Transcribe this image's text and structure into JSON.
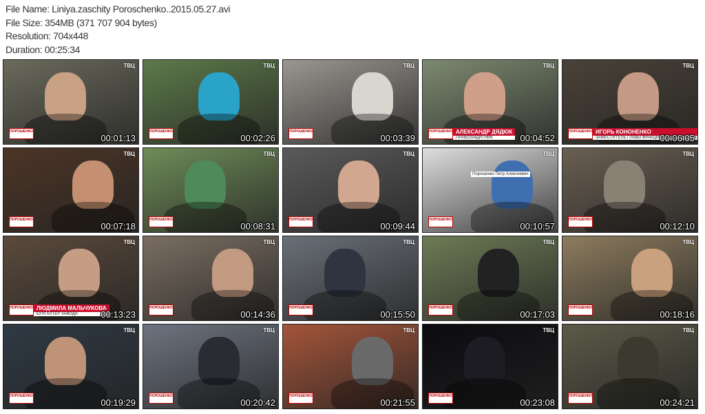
{
  "info": {
    "file_name": "File Name: Liniya.zaschity Poroschenko..2015.05.27.avi",
    "file_size": "File Size: 354MB (371 707 904 bytes)",
    "resolution": "Resolution: 704x448",
    "duration": "Duration: 00:25:34"
  },
  "logo_text": "ПОРОШЕНКО",
  "channel_mark": "ТВЦ",
  "thumbnails": [
    {
      "time": "00:01:13",
      "bg": "#6b6a5c",
      "fg": "#c9a184"
    },
    {
      "time": "00:02:26",
      "bg": "#5d7a4a",
      "fg": "#2aa3c8"
    },
    {
      "time": "00:03:39",
      "bg": "#9a9690",
      "fg": "#d8d6cf"
    },
    {
      "time": "00:04:52",
      "bg": "#7c8a70",
      "fg": "#cf9f8a",
      "caption": "АЛЕКСАНДР ДЯДЮК",
      "sub": "ПРАВОЗАЩИТНИК"
    },
    {
      "time": "00:06:05",
      "bg": "#4a4238",
      "fg": "#c49a84",
      "caption": "ИГОРЬ КОНОНЕНКО",
      "sub": "ЗАМЕСТИТЕЛЬ ГЛАВЫ ФРАКЦИИ «БЛОК ПЕТРА ПОРОШЕНКО»"
    },
    {
      "time": "00:07:18",
      "bg": "#4c3526",
      "fg": "#c49071"
    },
    {
      "time": "00:08:31",
      "bg": "#6f8c58",
      "fg": "#4f8a5a"
    },
    {
      "time": "00:09:44",
      "bg": "#5a5a5a",
      "fg": "#d1a88f"
    },
    {
      "time": "00:10:57",
      "bg": "#dedede",
      "fg": "#3f6fb0",
      "page_title": "Порошенко Петр Алексеевич"
    },
    {
      "time": "00:12:10",
      "bg": "#6a5f52",
      "fg": "#8a8175"
    },
    {
      "time": "00:13:23",
      "bg": "#5b4a3c",
      "fg": "#c49d84",
      "caption": "ЛЮДМИЛА МАЛЬЧУКОВА",
      "sub": "БУХГАЛТЕР ЗАВОДА"
    },
    {
      "time": "00:14:36",
      "bg": "#7a6e62",
      "fg": "#c19a81"
    },
    {
      "time": "00:15:50",
      "bg": "#6a7078",
      "fg": "#2f3540"
    },
    {
      "time": "00:17:03",
      "bg": "#6d7b55",
      "fg": "#222222"
    },
    {
      "time": "00:18:16",
      "bg": "#8d7c5e",
      "fg": "#c9a17f"
    },
    {
      "time": "00:19:29",
      "bg": "#2f3a44",
      "fg": "#bf9378"
    },
    {
      "time": "00:20:42",
      "bg": "#6e7480",
      "fg": "#2a2c33"
    },
    {
      "time": "00:21:55",
      "bg": "#a4553a",
      "fg": "#6a6a6a"
    },
    {
      "time": "00:23:08",
      "bg": "#0c0c10",
      "fg": "#1c1c22"
    },
    {
      "time": "00:24:21",
      "bg": "#5c5a48",
      "fg": "#3a3a2e"
    }
  ]
}
